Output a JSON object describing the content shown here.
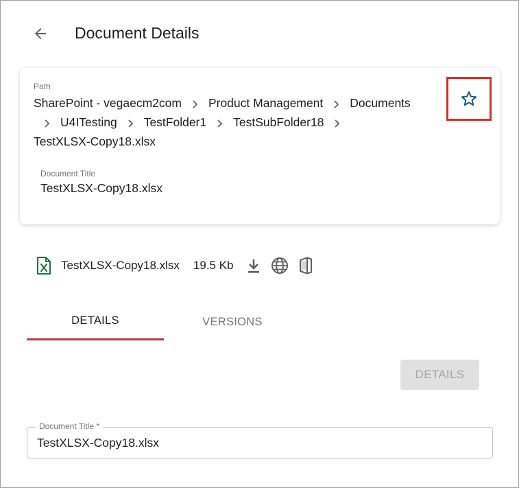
{
  "header": {
    "title": "Document Details",
    "back_icon": "arrow-left-icon"
  },
  "card": {
    "path_label": "Path",
    "breadcrumb": [
      "SharePoint - vegaecm2com",
      "Product Management",
      "Documents",
      "U4ITesting",
      "TestFolder1",
      "TestSubFolder18",
      "TestXLSX-Copy18.xlsx"
    ],
    "favorite_icon": "star-outline-icon",
    "favorite_color": "#1a5a8a",
    "highlight_color": "#d32f2f",
    "doc_title_label": "Document Title",
    "doc_title_value": "TestXLSX-Copy18.xlsx"
  },
  "file": {
    "type_icon": "excel-file-icon",
    "type_color": "#217346",
    "name": "TestXLSX-Copy18.xlsx",
    "size": "19.5 Kb",
    "actions": [
      "download-icon",
      "globe-icon",
      "office-icon"
    ]
  },
  "tabs": [
    {
      "label": "DETAILS",
      "active": true
    },
    {
      "label": "VERSIONS",
      "active": false
    }
  ],
  "tab_accent_color": "#b53a40",
  "details_button": {
    "label": "DETAILS",
    "disabled": true
  },
  "form": {
    "document_title": {
      "label": "Document Title *",
      "value": "TestXLSX-Copy18.xlsx"
    }
  }
}
